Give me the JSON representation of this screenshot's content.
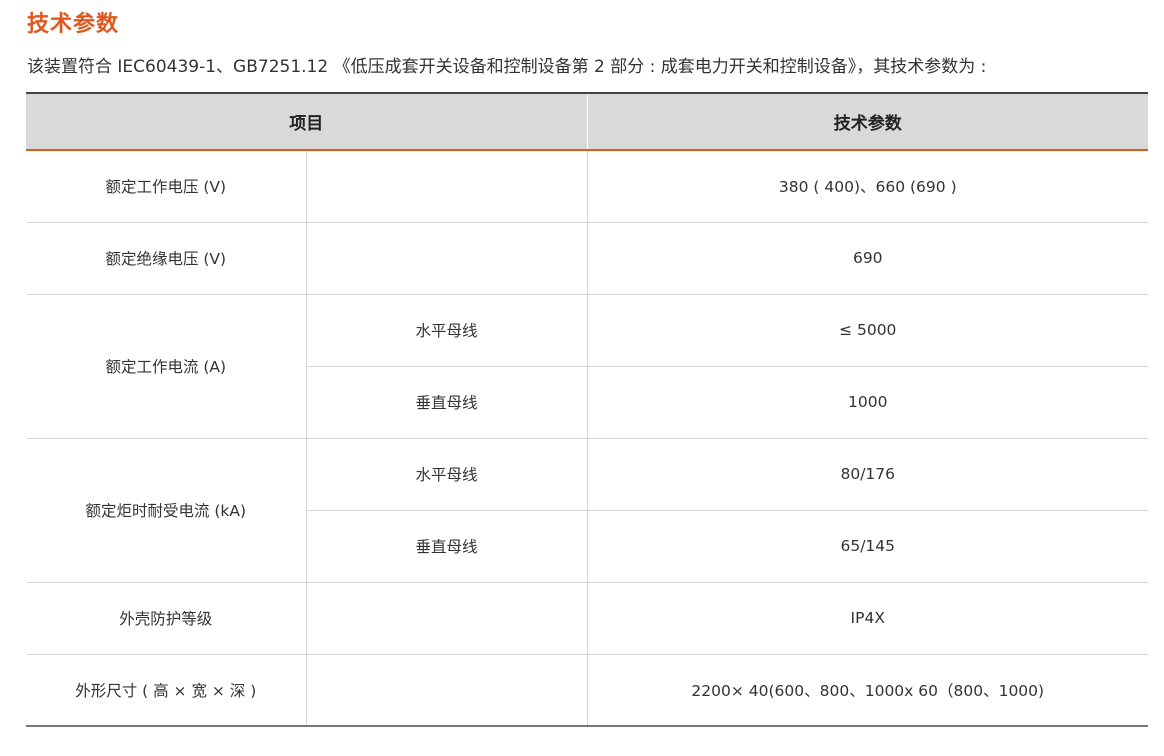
{
  "section_title": "技术参数",
  "intro": "该装置符合 IEC60439-1、GB7251.12 《低压成套开关设备和控制设备第 2 部分 : 成套电力开关和控制设备》，其技术参数为 :",
  "table": {
    "headers": [
      "项目",
      "技术参数"
    ],
    "rows": {
      "rated_voltage": {
        "item": "额定工作电压 (V)",
        "sub": "",
        "value": "380 ( 400)、660 (690 )"
      },
      "insulation_voltage": {
        "item": "额定绝缘电压 (V)",
        "sub": "",
        "value": "690"
      },
      "rated_current": {
        "item": "额定工作电流 (A)",
        "sub1": "水平母线",
        "value1": "≤ 5000",
        "sub2": "垂直母线",
        "value2": "1000"
      },
      "short_time_current": {
        "item": "额定炬时耐受电流 (kA)",
        "sub1": "水平母线",
        "value1": "80/176",
        "sub2": "垂直母线",
        "value2": "65/145"
      },
      "protection": {
        "item": "外壳防护等级",
        "sub": "",
        "value": "IP4X"
      },
      "dimensions": {
        "item": "外形尺寸 ( 高 × 宽 × 深 )",
        "sub": "",
        "value": "2200× 40(600、800、1000x 60（800、1000)"
      }
    }
  },
  "colors": {
    "accent": "#e0581e",
    "header_bg": "#d9d9d9",
    "grid": "#d6d6d6"
  }
}
